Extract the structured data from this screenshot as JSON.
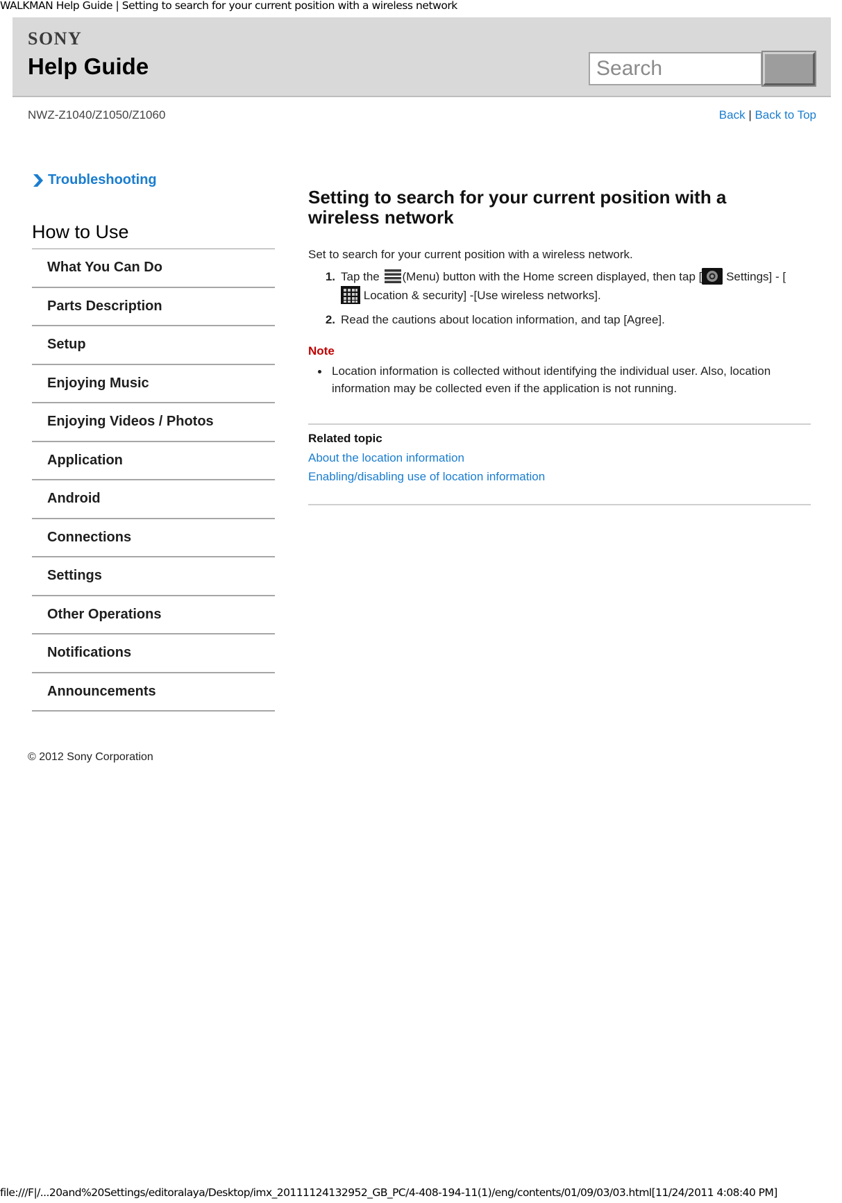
{
  "window": {
    "doc_title": "WALKMAN Help Guide | Setting to search for your current position with a wireless network",
    "footer_url": "file:///F|/...20and%20Settings/editoralaya/Desktop/imx_20111124132952_GB_PC/4-408-194-11(1)/eng/contents/01/09/03/03.html[11/24/2011 4:08:40 PM]"
  },
  "header": {
    "brand": "SONY",
    "title": "Help Guide",
    "search_placeholder": "Search",
    "search_button_label": ""
  },
  "subheader": {
    "model": "NWZ-Z1040/Z1050/Z1060",
    "back_label": "Back",
    "separator": "|",
    "back_to_top_label": "Back to Top"
  },
  "sidebar": {
    "troubleshooting_label": "Troubleshooting",
    "section_title": "How to Use",
    "items": [
      {
        "label": "What You Can Do"
      },
      {
        "label": "Parts Description"
      },
      {
        "label": "Setup"
      },
      {
        "label": "Enjoying Music"
      },
      {
        "label": "Enjoying Videos / Photos"
      },
      {
        "label": "Application"
      },
      {
        "label": "Android"
      },
      {
        "label": "Connections"
      },
      {
        "label": "Settings"
      },
      {
        "label": "Other Operations"
      },
      {
        "label": "Notifications"
      },
      {
        "label": "Announcements"
      }
    ],
    "copyright": "© 2012 Sony Corporation"
  },
  "main": {
    "title": "Setting to search for your current position with a wireless network",
    "intro": "Set to search for your current position with a wireless network.",
    "steps": [
      {
        "number": "1.",
        "parts": {
          "a": "Tap the",
          "icon1": "menu-icon",
          "b": "(Menu) button with the Home screen displayed, then tap [",
          "icon2": "settings-icon",
          "c": "Settings] - [",
          "icon3": "location-grid-icon",
          "d": "Location & security] -[Use wireless networks]."
        }
      },
      {
        "number": "2.",
        "text": "Read the cautions about location information, and tap [Agree]."
      }
    ],
    "note_label": "Note",
    "notes": [
      "Location information is collected without identifying the individual user. Also, location information may be collected even if the application is not running."
    ],
    "related_title": "Related topic",
    "related_links": [
      "About the location information",
      "Enabling/disabling use of location information"
    ]
  },
  "colors": {
    "link": "#1a7dcf",
    "note": "#c00000",
    "header_bg": "#d9d9d9"
  }
}
